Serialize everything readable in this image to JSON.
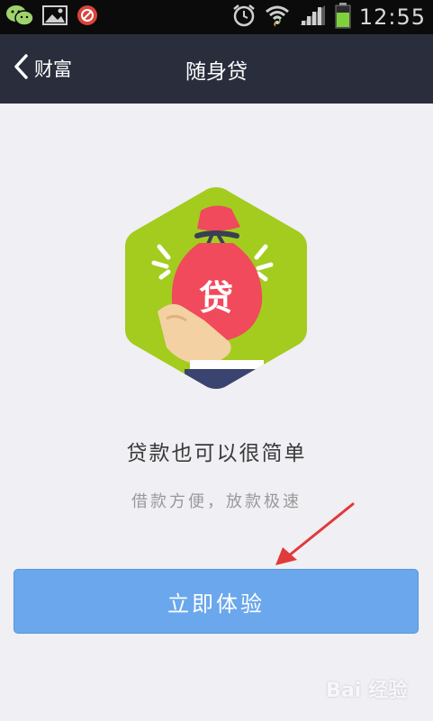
{
  "status_bar": {
    "time": "12:55",
    "icons": [
      "wechat-icon",
      "gallery-icon",
      "block-icon",
      "alarm-icon",
      "wifi-icon",
      "signal-icon",
      "battery-icon"
    ]
  },
  "nav": {
    "back_label": "财富",
    "title": "随身贷"
  },
  "hero": {
    "badge_char": "贷",
    "hex_color": "#a3cc1f",
    "bag_color": "#f04a5c"
  },
  "content": {
    "headline": "贷款也可以很简单",
    "subline": "借款方便，放款极速"
  },
  "cta": {
    "label": "立即体验",
    "color": "#6aa7ec"
  },
  "watermark": {
    "text": "Bai  经验"
  }
}
